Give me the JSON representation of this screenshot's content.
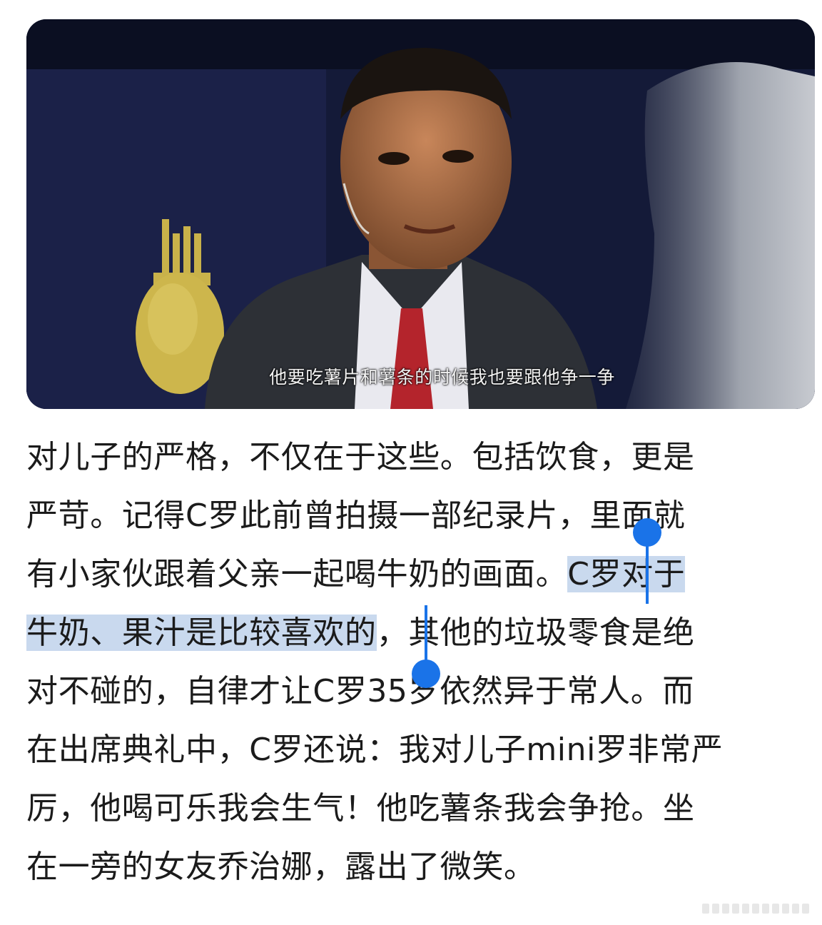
{
  "image": {
    "subtitle": "他要吃薯片和薯条的时候我也要跟他争一争",
    "colors": {
      "backdrop": "#141a38",
      "suit": "#2d3036",
      "tie": "#b4242c",
      "trophy": "#c9b24a"
    }
  },
  "article": {
    "line1": "对儿子的严格，不仅在于这些。包括饮食，更是",
    "line2": "严苛。记得C罗此前曾拍摄一部纪录片，里面就",
    "line3_plain": "有小家伙跟着父亲一起喝牛奶的画面。",
    "line3_selected": "C罗对于",
    "line4_selected": "牛奶、果汁是比较喜欢的",
    "line4_plain": "，其他的垃圾零食是绝",
    "line5": "对不碰的，自律才让C罗35岁依然异于常人。而",
    "line6": "在出席典礼中，C罗还说：我对儿子mini罗非常严",
    "line7": "厉，他喝可乐我会生气！他吃薯条我会争抢。坐",
    "line8": "在一旁的女友乔治娜，露出了微笑。"
  },
  "selection": {
    "highlight_color": "#c9d9ee",
    "handle_color": "#1a73e8"
  }
}
